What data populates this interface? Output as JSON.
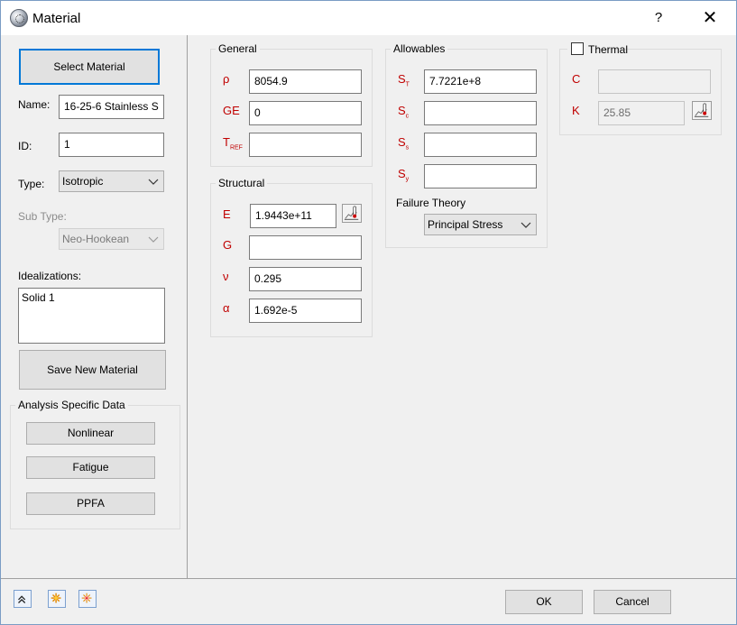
{
  "window": {
    "title": "Material",
    "help": "?",
    "close": "✕"
  },
  "left": {
    "select_material": "Select Material",
    "name_label": "Name:",
    "name_value": "16-25-6 Stainless S",
    "id_label": "ID:",
    "id_value": "1",
    "type_label": "Type:",
    "type_value": "Isotropic",
    "subtype_label": "Sub Type:",
    "subtype_value": "Neo-Hookean",
    "idealizations_label": "Idealizations:",
    "idealizations": [
      "Solid 1"
    ],
    "save_new": "Save New Material",
    "analysis_title": "Analysis Specific Data",
    "nonlinear": "Nonlinear",
    "fatigue": "Fatigue",
    "ppfa": "PPFA"
  },
  "general": {
    "title": "General",
    "rho": {
      "symbol": "ρ",
      "value": "8054.9"
    },
    "ge": {
      "symbol": "GE",
      "value": "0"
    },
    "tref": {
      "symbol": "T",
      "sub": "REF",
      "value": ""
    }
  },
  "structural": {
    "title": "Structural",
    "e": {
      "symbol": "E",
      "value": "1.9443e+11"
    },
    "g": {
      "symbol": "G",
      "value": ""
    },
    "nu": {
      "symbol": "ν",
      "value": "0.295"
    },
    "alpha": {
      "symbol": "α",
      "value": "1.692e-5"
    }
  },
  "allowables": {
    "title": "Allowables",
    "st": {
      "symbol": "S",
      "sub": "T",
      "value": "7.7221e+8"
    },
    "sc": {
      "symbol": "S",
      "sub": "c",
      "value": ""
    },
    "ss": {
      "symbol": "S",
      "sub": "s",
      "value": ""
    },
    "sy": {
      "symbol": "S",
      "sub": "y",
      "value": ""
    },
    "failure_label": "Failure Theory",
    "failure_value": "Principal Stress"
  },
  "thermal": {
    "title": "Thermal",
    "checked": false,
    "c": {
      "symbol": "C",
      "value": ""
    },
    "k": {
      "symbol": "K",
      "value": "25.85"
    }
  },
  "footer": {
    "ok": "OK",
    "cancel": "Cancel"
  },
  "colors": {
    "accent": "#0078d7",
    "symbol_red": "#c00000"
  }
}
